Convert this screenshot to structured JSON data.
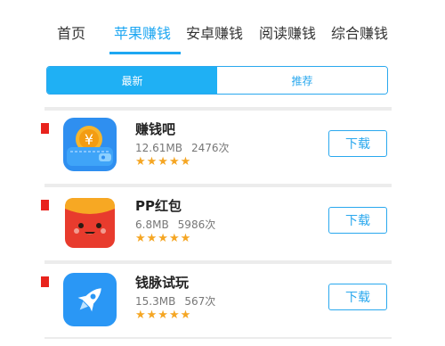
{
  "tabs": [
    {
      "label": "首页",
      "active": false
    },
    {
      "label": "苹果赚钱",
      "active": true
    },
    {
      "label": "安卓赚钱",
      "active": false
    },
    {
      "label": "阅读赚钱",
      "active": false
    },
    {
      "label": "综合赚钱",
      "active": false
    }
  ],
  "segments": [
    {
      "label": "最新",
      "active": true
    },
    {
      "label": "推荐",
      "active": false
    }
  ],
  "apps": [
    {
      "name": "赚钱吧",
      "size": "12.61MB",
      "downloads": "2476次",
      "rating": 5,
      "stars": "★★★★★",
      "button": "下载",
      "icon": "wallet-coin-icon"
    },
    {
      "name": "PP红包",
      "size": "6.8MB",
      "downloads": "5986次",
      "rating": 5,
      "stars": "★★★★★",
      "button": "下载",
      "icon": "red-envelope-face-icon"
    },
    {
      "name": "钱脉试玩",
      "size": "15.3MB",
      "downloads": "567次",
      "rating": 5,
      "stars": "★★★★★",
      "button": "下载",
      "icon": "rocket-icon"
    }
  ],
  "colors": {
    "accent": "#1ea7f2",
    "star": "#f5a623",
    "rank_flag": "#e8231d"
  }
}
